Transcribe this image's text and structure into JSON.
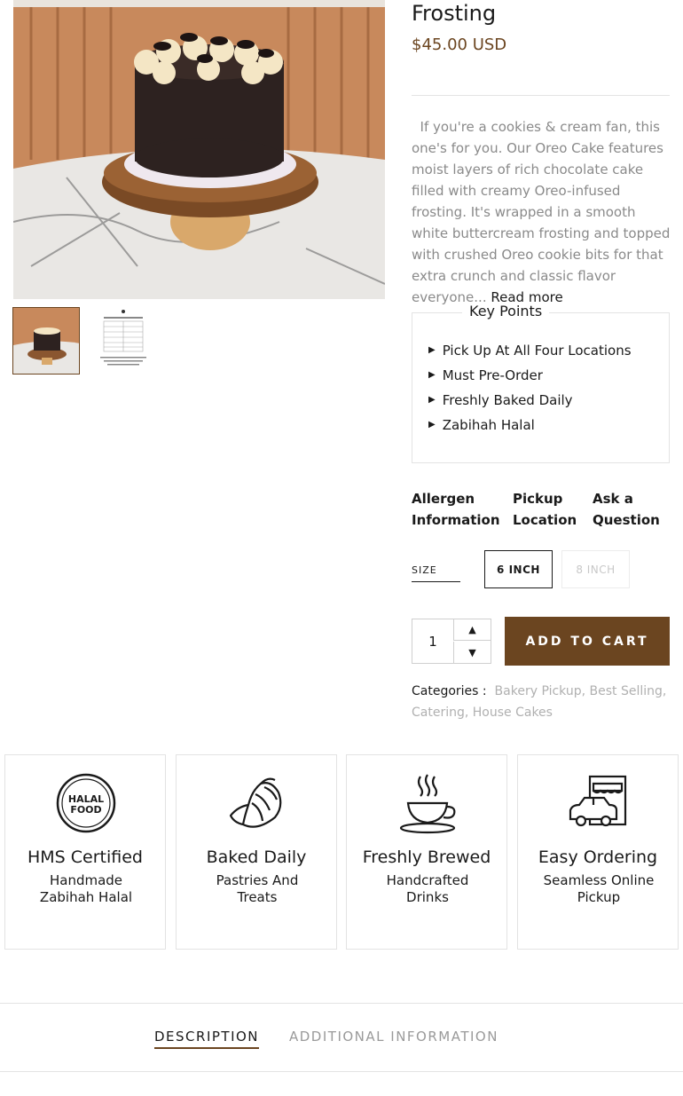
{
  "product": {
    "title": "Frosting",
    "price": "$45.00 USD",
    "description": "If you're a cookies & cream fan, this one's for you. Our Oreo Cake features moist layers of rich chocolate cake filled with creamy Oreo-infused frosting. It's wrapped in a smooth white buttercream frosting and topped with crushed Oreo cookie bits for that extra crunch and classic flavor everyone...",
    "read_more": "Read more"
  },
  "key_points": {
    "title": "Key Points",
    "items": [
      "Pick Up At All Four Locations",
      "Must Pre-Order",
      "Freshly Baked Daily",
      "Zabihah Halal"
    ]
  },
  "info_links": [
    "Allergen Information",
    "Pickup Location",
    "Ask a Question"
  ],
  "size": {
    "label": "SIZE",
    "options": [
      "6 INCH",
      "8 INCH"
    ],
    "selected": "6 INCH"
  },
  "cart": {
    "quantity": "1",
    "add_to_cart": "ADD TO CART"
  },
  "categories": {
    "label": "Categories :",
    "items": [
      "Bakery Pickup,",
      "Best Selling,",
      "Catering,",
      "House Cakes"
    ]
  },
  "features": [
    {
      "title": "HMS Certified",
      "subtitle": "Handmade Zabihah Halal",
      "icon": "halal-food-icon",
      "icon_text": "HALAL FOOD"
    },
    {
      "title": "Baked Daily",
      "subtitle": "Pastries And Treats",
      "icon": "croissant-icon"
    },
    {
      "title": "Freshly Brewed",
      "subtitle": "Handcrafted Drinks",
      "icon": "coffee-cup-icon"
    },
    {
      "title": "Easy Ordering",
      "subtitle": "Seamless Online Pickup",
      "icon": "drive-pickup-icon"
    }
  ],
  "tabs": [
    "DESCRIPTION",
    "ADDITIONAL INFORMATION"
  ],
  "colors": {
    "accent": "#6b4520",
    "muted_text": "#8a8a8a",
    "border": "#e3e3e3"
  }
}
